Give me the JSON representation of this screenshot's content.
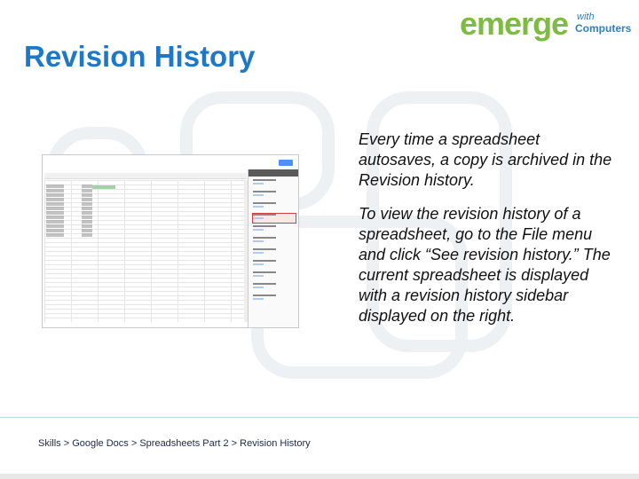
{
  "brand": {
    "logo_word": "emerge",
    "logo_with": "with",
    "logo_computers": "Computers",
    "colors": {
      "title": "#1e78c8",
      "logo_green": "#7dbb42",
      "logo_blue": "#2f7fb8"
    }
  },
  "slide": {
    "title": "Revision History",
    "paragraphs": [
      "Every time a spreadsheet autosaves, a copy is archived in the Revision history.",
      "To view the revision history of a spreadsheet, go to the File menu and click “See revision history.” The current spreadsheet is displayed with a revision history sidebar displayed on the right."
    ],
    "footer": "Skills > Google Docs > Spreadsheets Part 2 > Revision History"
  },
  "screenshot": {
    "icon": "spreadsheet-revision-history-screenshot"
  }
}
